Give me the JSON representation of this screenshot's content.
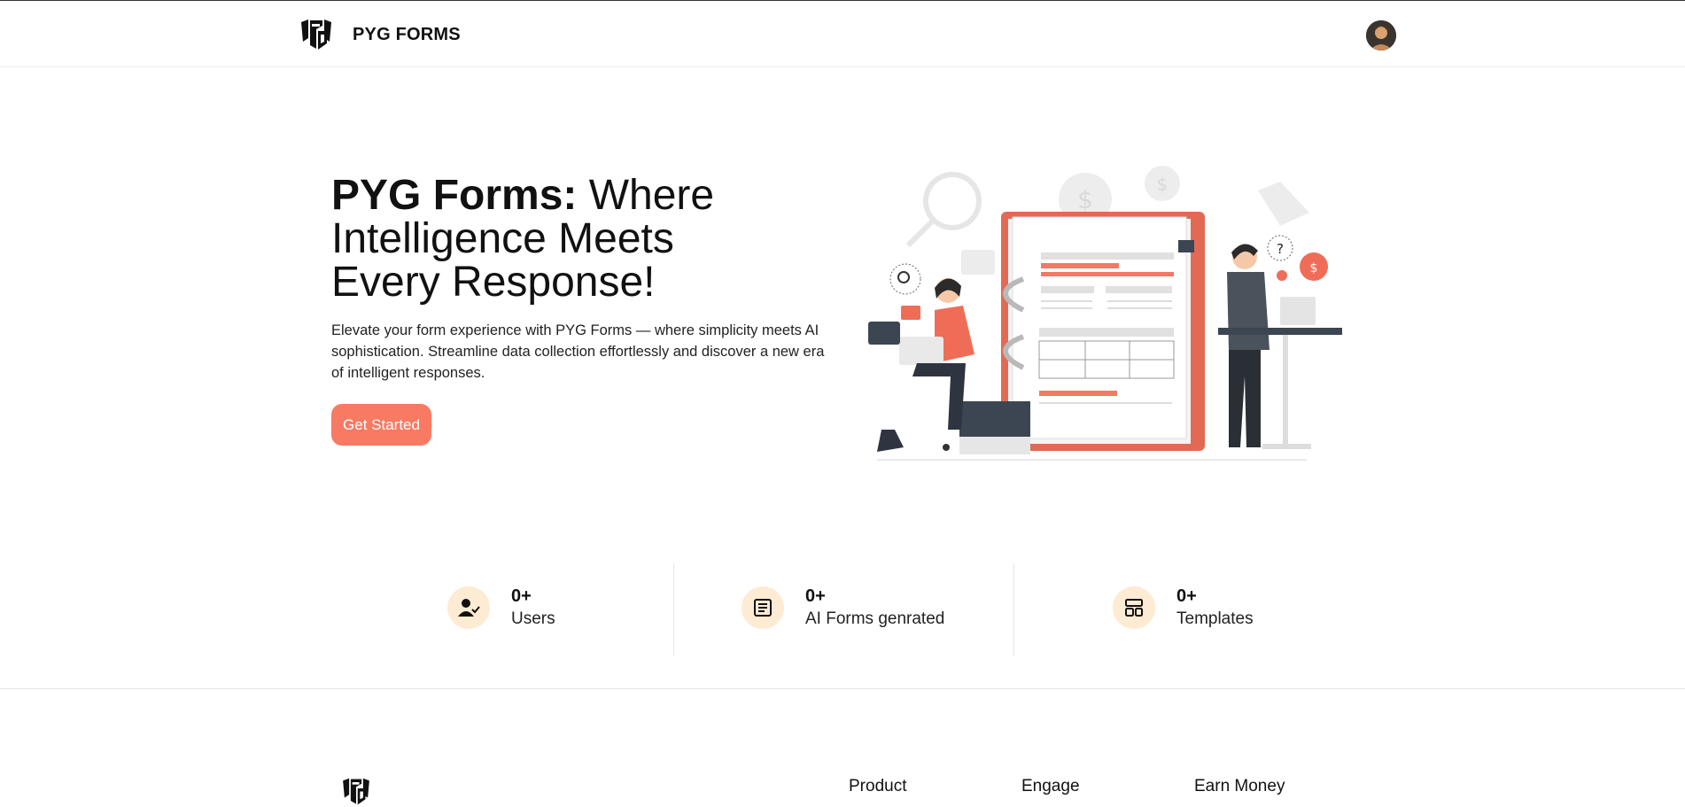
{
  "header": {
    "brand_name": "PYG FORMS",
    "logo_icon": "pyg-shield-logo",
    "avatar_icon": "user-avatar"
  },
  "hero": {
    "title_strong": "PYG Forms:",
    "title_rest": " Where Intelligence Meets Every Response!",
    "description": "Elevate your form experience with PYG Forms — where simplicity meets AI sophistication. Streamline data collection effortlessly and discover a new era of intelligent responses.",
    "cta_label": "Get Started",
    "illustration": "forms-illustration"
  },
  "stats": [
    {
      "value": "0+",
      "label": "Users",
      "icon": "user-check-icon"
    },
    {
      "value": "0+",
      "label": "AI Forms genrated",
      "icon": "form-list-icon"
    },
    {
      "value": "0+",
      "label": "Templates",
      "icon": "template-icon"
    }
  ],
  "footer": {
    "columns": [
      "Product",
      "Engage",
      "Earn Money"
    ]
  },
  "colors": {
    "accent": "#f87a63",
    "stat_icon_bg": "#fdebd3",
    "text": "#111111"
  }
}
